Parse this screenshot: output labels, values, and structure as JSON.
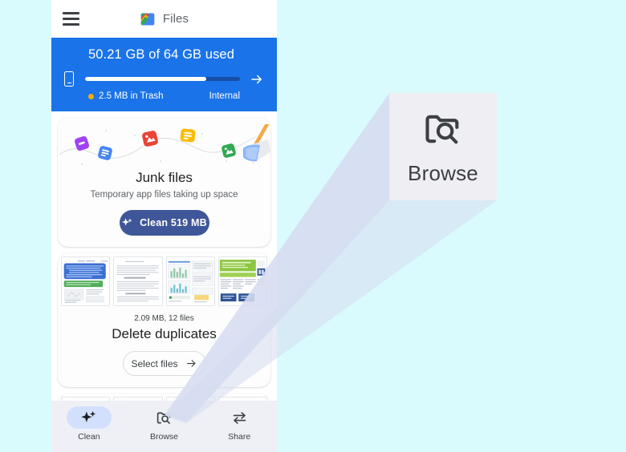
{
  "app": {
    "name": "Files",
    "logo_icon": "files-logo-icon",
    "menu_icon": "hamburger-menu-icon"
  },
  "storage": {
    "title": "50.21 GB of 64 GB used",
    "used_percent": 78,
    "device_icon": "phone-icon",
    "arrow_icon": "arrow-right-icon",
    "trash_label": "2.5 MB in Trash",
    "trash_dot_color": "#f9ab00",
    "location_label": "Internal",
    "banner_color": "#1a73e8"
  },
  "junk_card": {
    "title": "Junk files",
    "subtitle": "Temporary app files taking up space",
    "button_label": "Clean 519 MB",
    "button_icon": "sparkle-icon",
    "button_color": "#3f5699"
  },
  "duplicates_card": {
    "meta": "2.09 MB, 12 files",
    "title": "Delete duplicates",
    "button_label": "Select files",
    "button_icon": "arrow-right-icon",
    "thumbnails": [
      "document-thumbnail-1",
      "document-thumbnail-2",
      "document-thumbnail-3",
      "document-thumbnail-4"
    ]
  },
  "bottom_nav": {
    "items": [
      {
        "label": "Clean",
        "icon": "sparkle-icon",
        "active": true
      },
      {
        "label": "Browse",
        "icon": "folder-search-icon",
        "active": false
      },
      {
        "label": "Share",
        "icon": "share-transfer-icon",
        "active": false
      }
    ]
  },
  "callout": {
    "label": "Browse",
    "icon": "folder-search-icon",
    "background": "#eeeef3",
    "cone_color": "#d6dcf0"
  },
  "page": {
    "background": "#d9fbfd"
  }
}
